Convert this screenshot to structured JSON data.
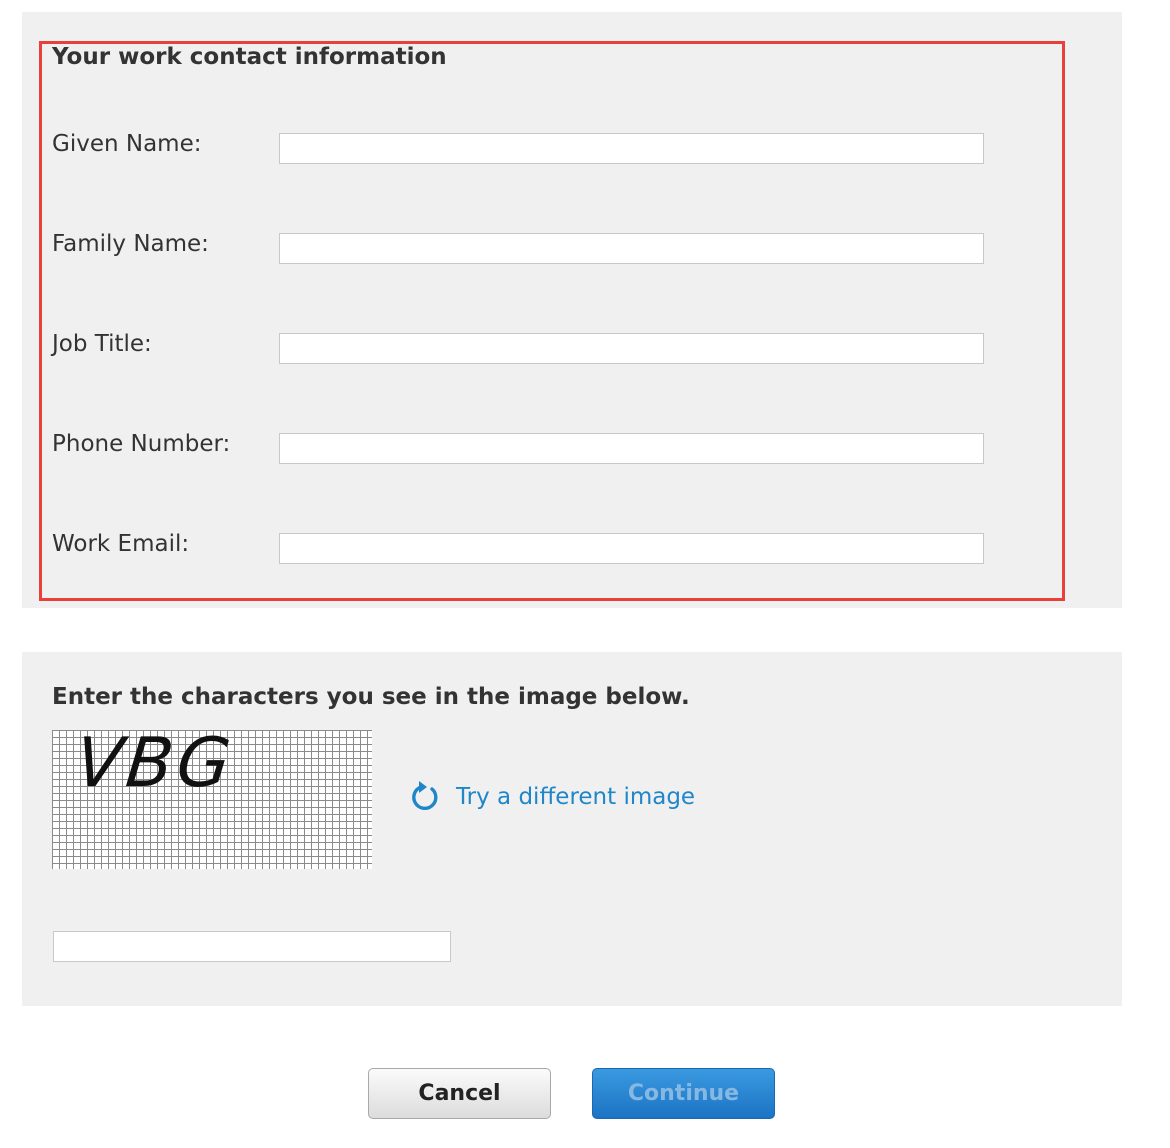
{
  "contact_section": {
    "title": "Your work contact information",
    "fields": [
      {
        "label": "Given Name:",
        "value": ""
      },
      {
        "label": "Family Name:",
        "value": ""
      },
      {
        "label": "Job Title:",
        "value": ""
      },
      {
        "label": "Phone Number:",
        "value": ""
      },
      {
        "label": "Work Email:",
        "value": ""
      }
    ],
    "highlight_color": "#e8413c"
  },
  "captcha_section": {
    "title": "Enter the characters you see in the image below.",
    "captcha_characters": "VBG",
    "refresh_label": "Try a different image",
    "refresh_icon": "refresh-icon",
    "input_value": ""
  },
  "actions": {
    "cancel_label": "Cancel",
    "continue_label": "Continue",
    "continue_color": "#1f86c9"
  },
  "colors": {
    "panel_background": "#f0f0f0",
    "link": "#1f86c9"
  }
}
